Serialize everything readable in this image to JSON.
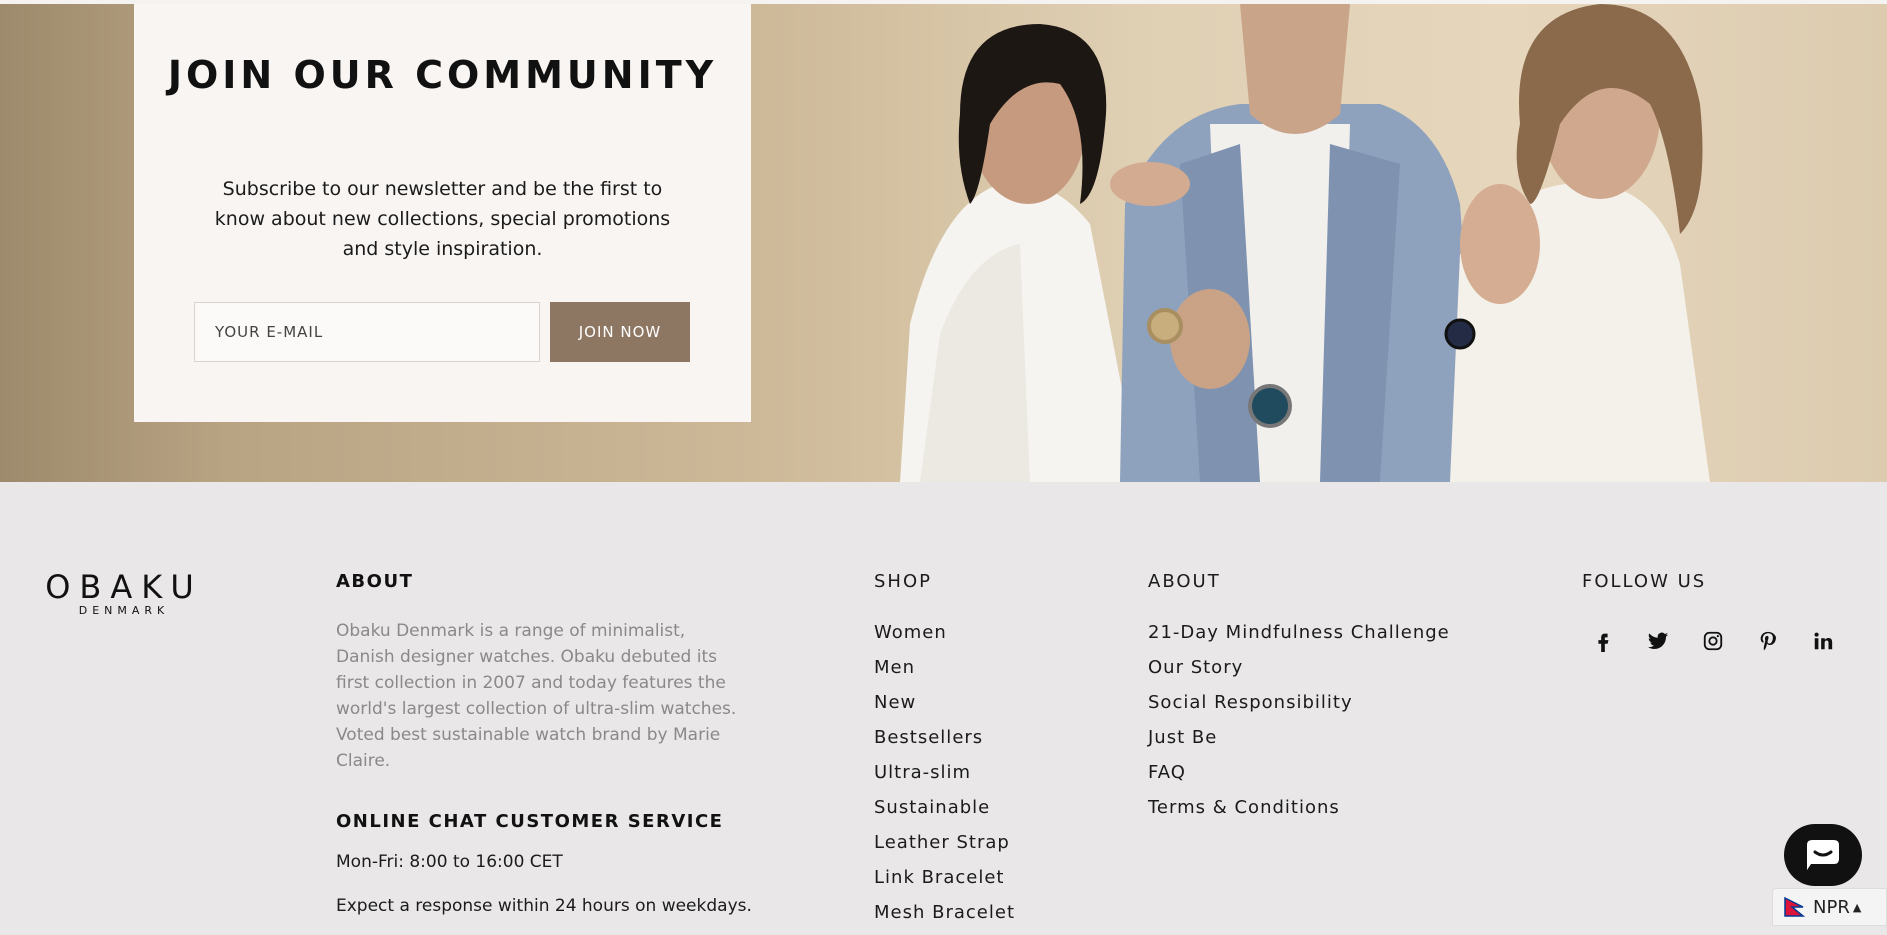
{
  "newsletter": {
    "title": "JOIN OUR COMMUNITY",
    "text": "Subscribe to our newsletter and be the first to know about new collections, special promotions and style inspiration.",
    "email_placeholder": "YOUR E-MAIL",
    "join_label": "JOIN NOW"
  },
  "brand": {
    "name": "OBAKU",
    "sub": "DENMARK"
  },
  "about": {
    "heading": "ABOUT",
    "text": "Obaku Denmark is a range of minimalist, Danish designer watches. Obaku debuted its first collection in 2007 and today features the world's largest collection of ultra-slim watches. Voted best sustainable watch brand by Marie Claire.",
    "chat_heading": "ONLINE CHAT CUSTOMER SERVICE",
    "chat_hours": "Mon-Fri: 8:00 to 16:00 CET",
    "chat_response": "Expect a response within 24 hours on weekdays."
  },
  "shop": {
    "heading": "SHOP",
    "items": [
      "Women",
      "Men",
      "New",
      "Bestsellers",
      "Ultra-slim",
      "Sustainable",
      "Leather Strap",
      "Link Bracelet",
      "Mesh Bracelet"
    ]
  },
  "about_links": {
    "heading": "ABOUT",
    "items": [
      "21-Day Mindfulness Challenge",
      "Our Story",
      "Social Responsibility",
      "Just Be",
      "FAQ",
      "Terms & Conditions"
    ]
  },
  "follow": {
    "heading": "FOLLOW US",
    "icons": [
      "facebook-icon",
      "twitter-icon",
      "instagram-icon",
      "pinterest-icon",
      "linkedin-icon"
    ]
  },
  "currency": {
    "code": "NPR"
  },
  "colors": {
    "accent": "#8e7762",
    "footer_bg": "#e9e7e7",
    "panel_bg": "#f8f5f3"
  }
}
